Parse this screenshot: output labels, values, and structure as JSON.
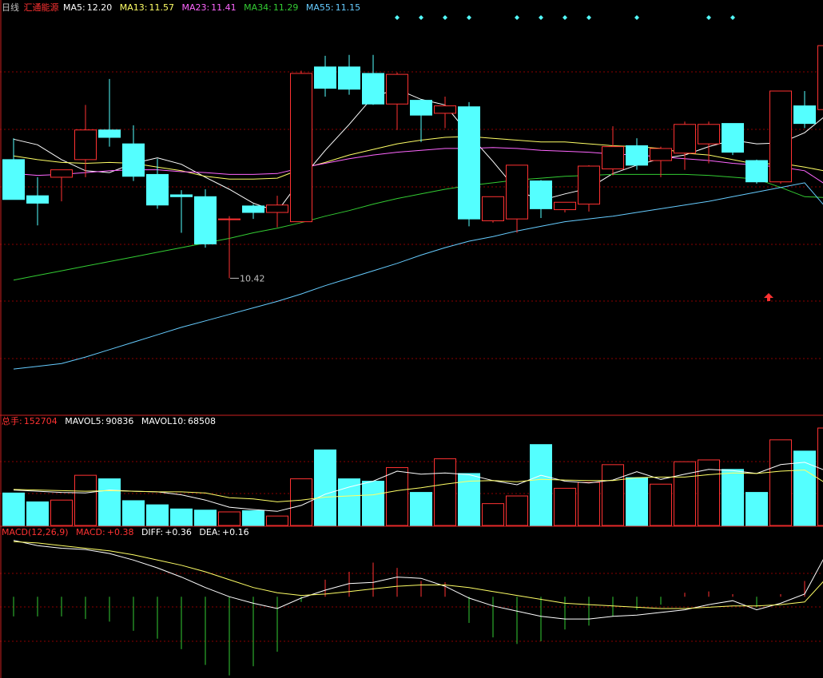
{
  "header": {
    "period": "日线",
    "stock_name": "汇通能源",
    "ma": [
      {
        "label": "MA5:",
        "value": "12.20",
        "color": "#ffffff"
      },
      {
        "label": "MA13:",
        "value": "11.57",
        "color": "#ffff66"
      },
      {
        "label": "MA23:",
        "value": "11.41",
        "color": "#ff66ff"
      },
      {
        "label": "MA34:",
        "value": "11.29",
        "color": "#33cc33"
      },
      {
        "label": "MA55:",
        "value": "11.15",
        "color": "#66ccff"
      }
    ]
  },
  "volume_header": {
    "label": "总手:",
    "value": "152704",
    "mavol5_label": "MAVOL5:",
    "mavol5": "90836",
    "mavol10_label": "MAVOL10:",
    "mavol10": "68508"
  },
  "macd_header": {
    "label": "MACD(12,26,9)",
    "macd_label": "MACD:",
    "macd": "+0.38",
    "diff_label": "DIFF:",
    "diff": "+0.36",
    "dea_label": "DEA:",
    "dea": "+0.16"
  },
  "colors": {
    "up": "#ff3232",
    "down": "#54ffff",
    "grid": "#8b0000",
    "border": "#cc2020",
    "diamond": "#54ffff",
    "arrow": "#ff3232"
  },
  "chart_data": [
    {
      "type": "candlestick",
      "title": "日线 汇通能源",
      "ylim": [
        8.95,
        13.25
      ],
      "candles": [
        {
          "o": 11.7,
          "h": 11.93,
          "l": 11.29,
          "c": 11.27
        },
        {
          "o": 11.31,
          "h": 11.51,
          "l": 10.99,
          "c": 11.23
        },
        {
          "o": 11.51,
          "h": 11.58,
          "l": 11.25,
          "c": 11.59
        },
        {
          "o": 11.7,
          "h": 12.29,
          "l": 11.51,
          "c": 12.02
        },
        {
          "o": 12.02,
          "h": 12.57,
          "l": 11.84,
          "c": 11.94
        },
        {
          "o": 11.87,
          "h": 12.07,
          "l": 11.47,
          "c": 11.52
        },
        {
          "o": 11.54,
          "h": 11.71,
          "l": 11.17,
          "c": 11.21
        },
        {
          "o": 11.32,
          "h": 11.37,
          "l": 10.91,
          "c": 11.3
        },
        {
          "o": 11.3,
          "h": 11.38,
          "l": 10.75,
          "c": 10.79
        },
        {
          "o": 11.06,
          "h": 11.09,
          "l": 10.42,
          "c": 11.06
        },
        {
          "o": 11.2,
          "h": 11.22,
          "l": 11.06,
          "c": 11.13
        },
        {
          "o": 11.13,
          "h": 11.31,
          "l": 10.97,
          "c": 11.21
        },
        {
          "o": 11.03,
          "h": 12.66,
          "l": 11.02,
          "c": 12.63
        },
        {
          "o": 12.7,
          "h": 12.82,
          "l": 12.38,
          "c": 12.47
        },
        {
          "o": 12.7,
          "h": 12.83,
          "l": 12.4,
          "c": 12.46
        },
        {
          "o": 12.63,
          "h": 12.83,
          "l": 12.29,
          "c": 12.3
        },
        {
          "o": 12.3,
          "h": 12.64,
          "l": 12.02,
          "c": 12.62
        },
        {
          "o": 12.34,
          "h": 12.35,
          "l": 11.89,
          "c": 12.18
        },
        {
          "o": 12.2,
          "h": 12.38,
          "l": 12.04,
          "c": 12.28
        },
        {
          "o": 12.27,
          "h": 12.32,
          "l": 10.98,
          "c": 11.06
        },
        {
          "o": 11.04,
          "h": 11.29,
          "l": 11.02,
          "c": 11.3
        },
        {
          "o": 11.06,
          "h": 11.64,
          "l": 10.91,
          "c": 11.64
        },
        {
          "o": 11.47,
          "h": 11.48,
          "l": 11.07,
          "c": 11.17
        },
        {
          "o": 11.16,
          "h": 11.24,
          "l": 11.13,
          "c": 11.24
        },
        {
          "o": 11.22,
          "h": 11.64,
          "l": 11.14,
          "c": 11.63
        },
        {
          "o": 11.6,
          "h": 12.06,
          "l": 11.53,
          "c": 11.84
        },
        {
          "o": 11.85,
          "h": 11.93,
          "l": 11.59,
          "c": 11.64
        },
        {
          "o": 11.69,
          "h": 11.84,
          "l": 11.51,
          "c": 11.82
        },
        {
          "o": 11.77,
          "h": 12.11,
          "l": 11.59,
          "c": 12.08
        },
        {
          "o": 11.87,
          "h": 12.11,
          "l": 11.66,
          "c": 12.08
        },
        {
          "o": 12.09,
          "h": 12.09,
          "l": 11.75,
          "c": 11.78
        },
        {
          "o": 11.69,
          "h": 11.7,
          "l": 11.44,
          "c": 11.46
        },
        {
          "o": 11.46,
          "h": 12.44,
          "l": 11.44,
          "c": 12.44
        },
        {
          "o": 12.28,
          "h": 12.44,
          "l": 12.04,
          "c": 12.09
        },
        {
          "o": 12.24,
          "h": 12.93,
          "l": 12.1,
          "c": 12.93
        }
      ],
      "moving_averages": [
        {
          "name": "MA5",
          "color": "#ffffff",
          "values": [
            11.92,
            11.86,
            11.7,
            11.58,
            11.56,
            11.66,
            11.72,
            11.65,
            11.51,
            11.38,
            11.23,
            11.14,
            11.49,
            11.8,
            12.08,
            12.38,
            12.46,
            12.35,
            12.29,
            11.97,
            11.68,
            11.37,
            11.26,
            11.33,
            11.39,
            11.55,
            11.64,
            11.71,
            11.75,
            11.84,
            11.91,
            11.87,
            11.88,
            11.99,
            12.2
          ]
        },
        {
          "name": "MA13",
          "color": "#ffff66",
          "values": [
            11.74,
            11.7,
            11.67,
            11.66,
            11.67,
            11.66,
            11.62,
            11.58,
            11.52,
            11.49,
            11.49,
            11.5,
            11.6,
            11.67,
            11.75,
            11.81,
            11.87,
            11.91,
            11.94,
            11.95,
            11.93,
            11.91,
            11.89,
            11.89,
            11.87,
            11.85,
            11.84,
            11.82,
            11.77,
            11.75,
            11.7,
            11.65,
            11.66,
            11.62,
            11.57
          ]
        },
        {
          "name": "MA23",
          "color": "#ff66ff",
          "values": [
            11.55,
            11.53,
            11.54,
            11.56,
            11.58,
            11.59,
            11.59,
            11.57,
            11.56,
            11.54,
            11.54,
            11.55,
            11.61,
            11.66,
            11.71,
            11.75,
            11.78,
            11.8,
            11.82,
            11.82,
            11.83,
            11.82,
            11.8,
            11.79,
            11.78,
            11.76,
            11.75,
            11.73,
            11.71,
            11.69,
            11.66,
            11.64,
            11.62,
            11.58,
            11.41
          ]
        },
        {
          "name": "MA34",
          "color": "#33cc33",
          "values": [
            10.4,
            10.45,
            10.5,
            10.55,
            10.6,
            10.65,
            10.7,
            10.75,
            10.8,
            10.85,
            10.91,
            10.96,
            11.02,
            11.09,
            11.15,
            11.22,
            11.28,
            11.33,
            11.38,
            11.42,
            11.45,
            11.48,
            11.5,
            11.52,
            11.53,
            11.54,
            11.54,
            11.54,
            11.54,
            11.53,
            11.51,
            11.49,
            11.4,
            11.3,
            11.29
          ]
        },
        {
          "name": "MA55",
          "color": "#66ccff",
          "values": [
            9.44,
            9.47,
            9.5,
            9.57,
            9.65,
            9.73,
            9.81,
            9.89,
            9.96,
            10.03,
            10.1,
            10.17,
            10.25,
            10.34,
            10.42,
            10.5,
            10.58,
            10.67,
            10.75,
            10.82,
            10.87,
            10.93,
            10.98,
            11.03,
            11.06,
            11.09,
            11.13,
            11.17,
            11.21,
            11.25,
            11.3,
            11.35,
            11.4,
            11.45,
            11.15
          ]
        }
      ],
      "annotations": {
        "low_label": "10.42",
        "low_index": 9,
        "signal_diamonds": [
          16,
          17,
          18,
          19,
          21,
          22,
          23,
          24,
          26,
          29,
          30
        ],
        "arrow_index": 32
      }
    },
    {
      "type": "bar",
      "title": "总手",
      "ylim": [
        0,
        165000
      ],
      "volume": [
        55000,
        40000,
        43000,
        85000,
        79000,
        42000,
        35000,
        28000,
        26000,
        23000,
        25000,
        16000,
        79000,
        128000,
        79000,
        75000,
        98000,
        56000,
        113000,
        88000,
        37000,
        50000,
        137000,
        63000,
        73000,
        103000,
        81000,
        70000,
        108000,
        111000,
        95000,
        56000,
        145000,
        126000,
        165000
      ],
      "mavol5": [
        60000,
        58000,
        56000,
        55000,
        60000,
        58000,
        57000,
        52000,
        43000,
        31000,
        27000,
        24000,
        34000,
        53000,
        65000,
        75000,
        92000,
        87000,
        89000,
        86000,
        76000,
        69000,
        85000,
        75000,
        72000,
        77000,
        91000,
        78000,
        87000,
        95000,
        93000,
        88000,
        103000,
        107000,
        90836
      ],
      "mavol10": [
        61000,
        60000,
        59000,
        58000,
        59000,
        58000,
        57000,
        57000,
        55000,
        47000,
        45000,
        40000,
        43000,
        48000,
        50000,
        52000,
        59000,
        64000,
        70000,
        75000,
        76000,
        74000,
        78000,
        77000,
        76000,
        76000,
        81000,
        82000,
        82000,
        86000,
        89000,
        88000,
        92000,
        94000,
        68508
      ]
    },
    {
      "type": "line",
      "title": "MACD(12,26,9)",
      "ylim": [
        -0.62,
        0.44
      ],
      "diff": [
        0.43,
        0.39,
        0.37,
        0.36,
        0.33,
        0.28,
        0.22,
        0.15,
        0.07,
        0.0,
        -0.05,
        -0.09,
        -0.01,
        0.05,
        0.1,
        0.11,
        0.15,
        0.14,
        0.08,
        -0.01,
        -0.07,
        -0.11,
        -0.15,
        -0.17,
        -0.17,
        -0.15,
        -0.14,
        -0.12,
        -0.1,
        -0.06,
        -0.03,
        -0.1,
        -0.05,
        0.02,
        0.36
      ],
      "dea": [
        0.42,
        0.41,
        0.39,
        0.37,
        0.35,
        0.32,
        0.28,
        0.24,
        0.19,
        0.13,
        0.07,
        0.03,
        0.01,
        0.02,
        0.04,
        0.06,
        0.08,
        0.09,
        0.09,
        0.07,
        0.04,
        0.01,
        -0.02,
        -0.05,
        -0.06,
        -0.07,
        -0.08,
        -0.09,
        -0.09,
        -0.08,
        -0.07,
        -0.07,
        -0.06,
        -0.04,
        0.16
      ],
      "macd": [
        -0.15,
        -0.15,
        -0.15,
        -0.17,
        -0.19,
        -0.26,
        -0.32,
        -0.4,
        -0.52,
        -0.6,
        -0.53,
        -0.42,
        -0.04,
        0.13,
        0.19,
        0.26,
        0.22,
        0.12,
        0.11,
        -0.2,
        -0.31,
        -0.36,
        -0.34,
        -0.25,
        -0.22,
        -0.15,
        -0.1,
        -0.06,
        0.03,
        0.04,
        0.02,
        -0.08,
        0.02,
        0.12,
        0.38
      ]
    }
  ]
}
